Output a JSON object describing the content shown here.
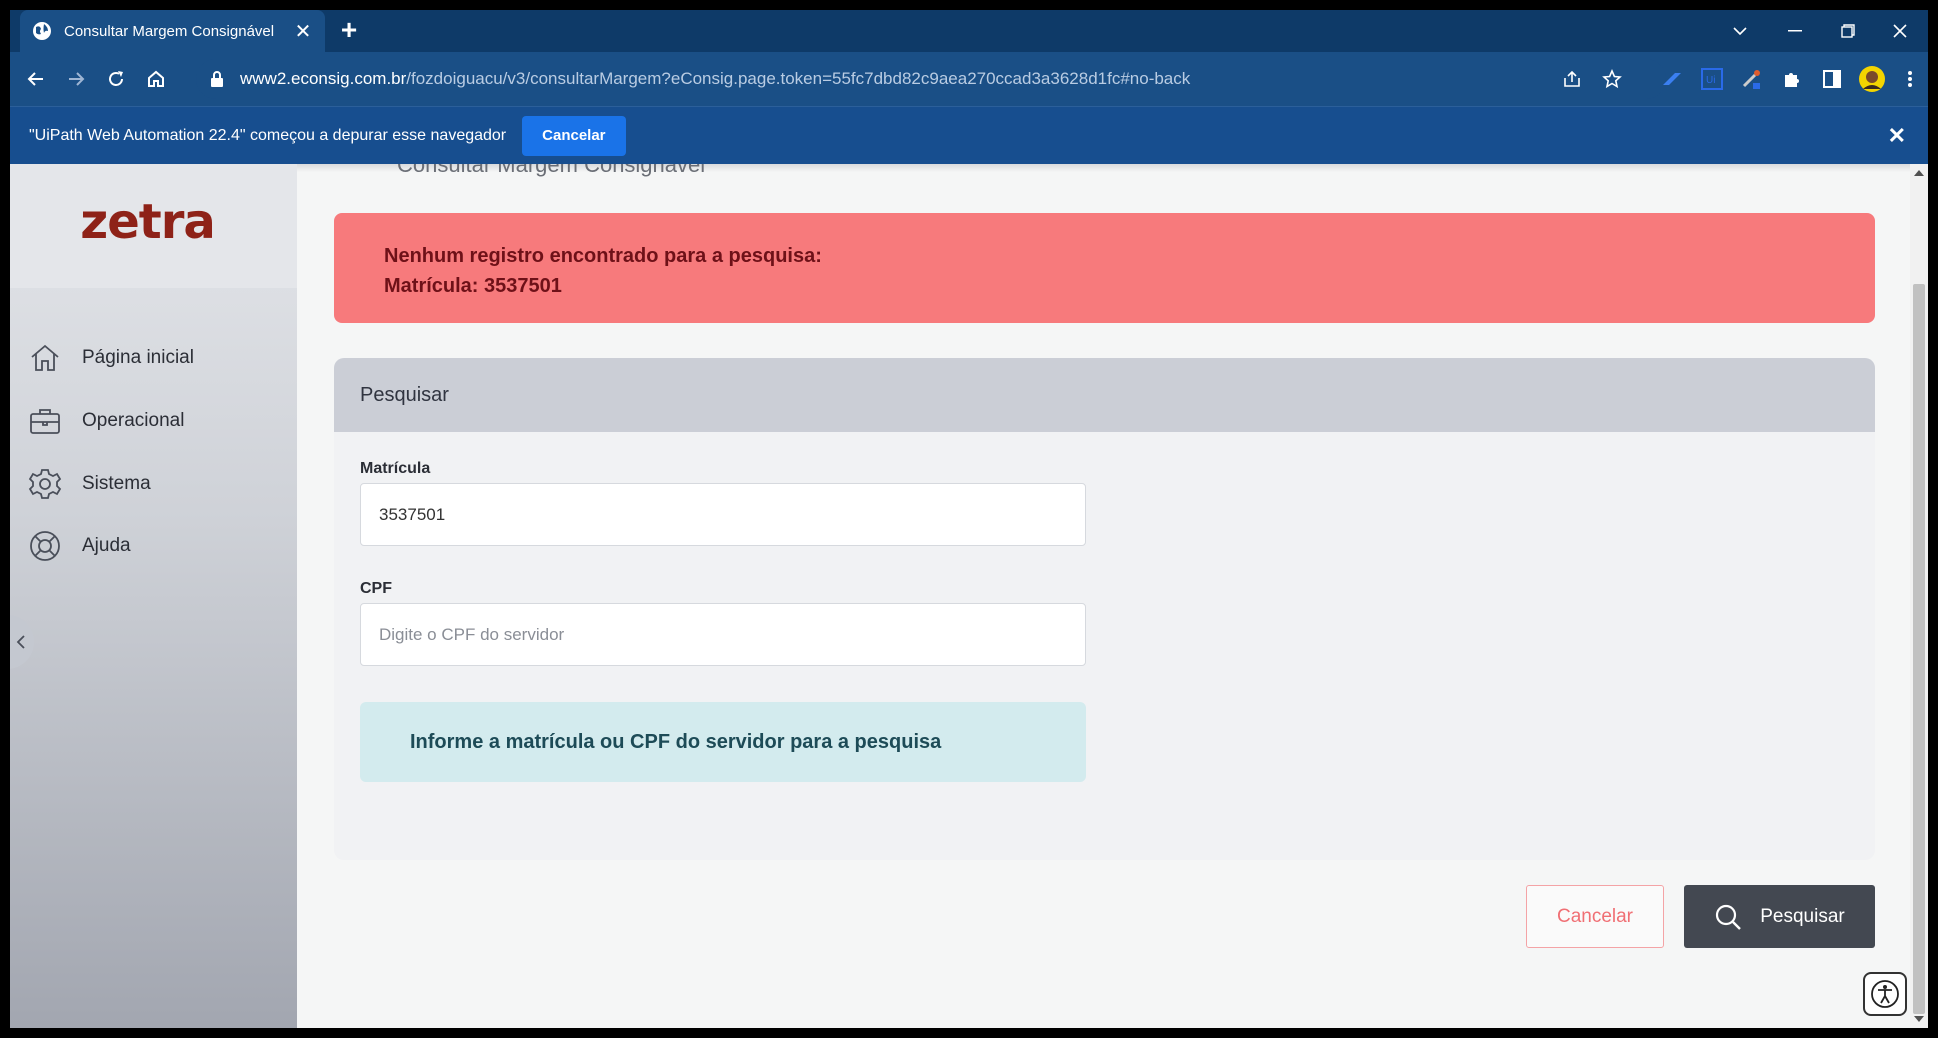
{
  "browser": {
    "tab_title": "Consultar Margem Consignável",
    "url_host": "www2.econsig.com.br",
    "url_path": "/fozdoiguacu/v3/consultarMargem?eConsig.page.token=55fc7dbd82c9aea270ccad3a3628d1fc#no-back"
  },
  "infobar": {
    "message": "\"UiPath Web Automation 22.4\" começou a depurar esse navegador",
    "cancel_label": "Cancelar"
  },
  "sidebar": {
    "logo_text": "zetra",
    "items": [
      {
        "label": "Página inicial",
        "icon": "home-icon"
      },
      {
        "label": "Operacional",
        "icon": "briefcase-icon"
      },
      {
        "label": "Sistema",
        "icon": "gear-icon"
      },
      {
        "label": "Ajuda",
        "icon": "lifebuoy-icon"
      }
    ]
  },
  "page": {
    "heading": "Consultar Margem Consignável",
    "alert": {
      "line1": "Nenhum registro encontrado para a pesquisa:",
      "line2": "Matrícula: 3537501",
      "color": "#f77a7c"
    },
    "search_card": {
      "title": "Pesquisar",
      "matricula_label": "Matrícula",
      "matricula_value": "3537501",
      "cpf_label": "CPF",
      "cpf_placeholder": "Digite o CPF do servidor",
      "hint": "Informe a matrícula ou CPF do servidor para a pesquisa"
    },
    "buttons": {
      "cancel_label": "Cancelar",
      "search_label": "Pesquisar"
    }
  }
}
